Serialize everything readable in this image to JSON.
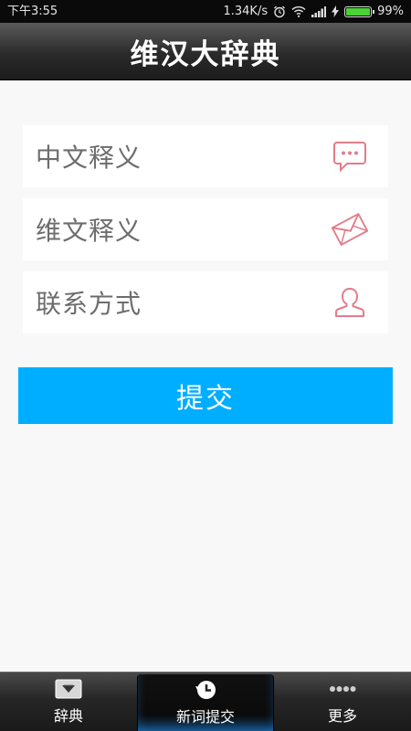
{
  "status_bar": {
    "time": "下午3:55",
    "network_speed": "1.34K/s",
    "battery_percent": "99%",
    "battery_level": 0.99,
    "icons": [
      "alarm-icon",
      "wifi-icon",
      "signal-icon",
      "charging-icon",
      "battery-icon"
    ]
  },
  "header": {
    "title": "维汉大辞典"
  },
  "form": {
    "fields": [
      {
        "label": "中文释义",
        "icon": "chat-bubble-icon"
      },
      {
        "label": "维文释义",
        "icon": "envelope-icon"
      },
      {
        "label": "联系方式",
        "icon": "person-icon"
      }
    ],
    "submit_label": "提交"
  },
  "bottom_nav": {
    "items": [
      {
        "label": "辞典",
        "icon": "dictionary-icon",
        "active": false
      },
      {
        "label": "新词提交",
        "icon": "history-icon",
        "active": true
      },
      {
        "label": "更多",
        "icon": "more-dots-icon",
        "active": false
      }
    ]
  },
  "colors": {
    "accent": "#00aeff",
    "icon_pink": "#e37c8a",
    "background": "#f8f8f8"
  }
}
